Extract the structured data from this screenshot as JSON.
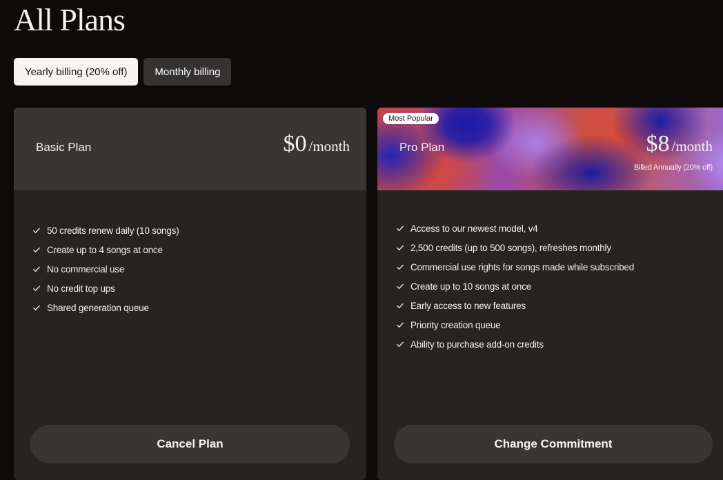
{
  "page": {
    "title": "All Plans"
  },
  "billing": {
    "yearly_label": "Yearly billing (20% off)",
    "monthly_label": "Monthly billing",
    "selected": "yearly"
  },
  "plans": {
    "basic": {
      "name": "Basic Plan",
      "price": "$0",
      "period": "/month",
      "features": [
        "50 credits renew daily (10 songs)",
        "Create up to 4 songs at once",
        "No commercial use",
        "No credit top ups",
        "Shared generation queue"
      ],
      "action_label": "Cancel Plan"
    },
    "pro": {
      "badge": "Most Popular",
      "name": "Pro Plan",
      "price": "$8",
      "period": "/month",
      "billed_note": "Billed Annually (20% off)",
      "features": [
        "Access to our newest model, v4",
        "2,500 credits (up to 500 songs), refreshes monthly",
        "Commercial use rights for songs made while subscribed",
        "Create up to 10 songs at once",
        "Early access to new features",
        "Priority creation queue",
        "Ability to purchase add-on credits"
      ],
      "action_label": "Change Commitment"
    }
  },
  "icons": {
    "feature_bullet": "check-icon"
  },
  "colors": {
    "background": "#0e0a0a",
    "card": "#262323",
    "card_header": "#393535",
    "active_toggle": "#f8f5f1"
  }
}
